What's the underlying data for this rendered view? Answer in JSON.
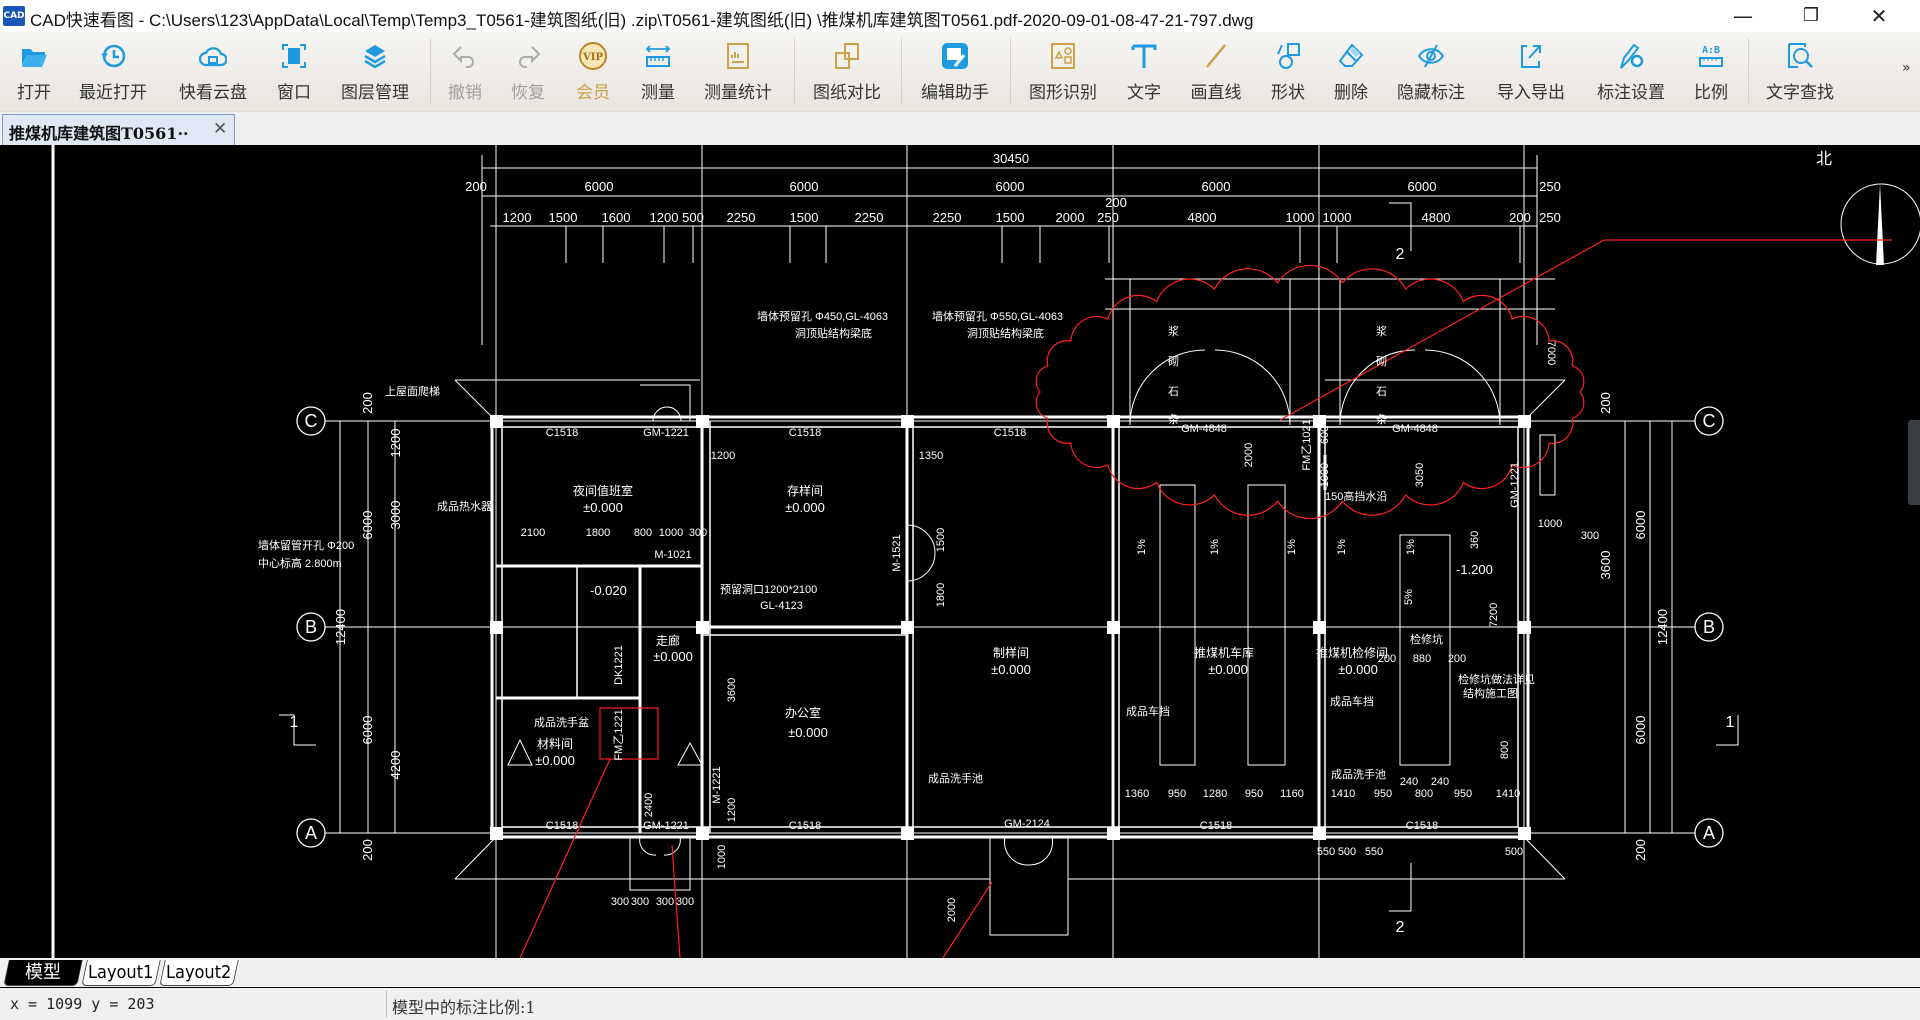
{
  "window": {
    "app_icon": "CAD",
    "title": "CAD快速看图 - C:\\Users\\123\\AppData\\Local\\Temp\\Temp3_T0561-建筑图纸(旧)  .zip\\T0561-建筑图纸(旧)  \\推煤机库建筑图T0561.pdf-2020-09-01-08-47-21-797.dwg",
    "minimize": "—",
    "restore": "❐",
    "close": "✕"
  },
  "toolbar": {
    "items": [
      {
        "label": "打开",
        "icon": "folder-open-icon"
      },
      {
        "label": "最近打开",
        "icon": "recent-clock-icon"
      },
      {
        "label": "快看云盘",
        "icon": "cloud-drive-icon"
      },
      {
        "label": "窗口",
        "icon": "window-icon"
      },
      {
        "label": "图层管理",
        "icon": "layers-icon"
      },
      {
        "label": "撤销",
        "icon": "undo-icon"
      },
      {
        "label": "恢复",
        "icon": "redo-icon"
      },
      {
        "label": "会员",
        "icon": "vip-icon"
      },
      {
        "label": "测量",
        "icon": "ruler-icon"
      },
      {
        "label": "测量统计",
        "icon": "measure-stats-icon"
      },
      {
        "label": "图纸对比",
        "icon": "compare-icon"
      },
      {
        "label": "编辑助手",
        "icon": "edit-assistant-icon"
      },
      {
        "label": "图形识别",
        "icon": "shape-recognize-icon"
      },
      {
        "label": "文字",
        "icon": "text-icon"
      },
      {
        "label": "画直线",
        "icon": "line-icon"
      },
      {
        "label": "形状",
        "icon": "shapes-icon"
      },
      {
        "label": "删除",
        "icon": "eraser-icon"
      },
      {
        "label": "隐藏标注",
        "icon": "hide-eye-icon"
      },
      {
        "label": "导入导出",
        "icon": "import-export-icon"
      },
      {
        "label": "标注设置",
        "icon": "annotation-settings-icon"
      },
      {
        "label": "比例",
        "icon": "scale-icon"
      },
      {
        "label": "文字查找",
        "icon": "text-search-icon"
      }
    ],
    "vip_badge": "VIP",
    "scale_badge": "A:B",
    "more": "»"
  },
  "document_tab": {
    "label": "推煤机库建筑图T0561··",
    "close": "✕"
  },
  "drawing": {
    "axes": {
      "C": "C",
      "B": "B",
      "A": "A"
    },
    "north": "北",
    "section_marks": {
      "one": "1",
      "two": "2"
    },
    "dims_top": {
      "overall": "30450",
      "left_offset": "200",
      "right_offset": "250",
      "bays": [
        "6000",
        "6000",
        "6000",
        "6000",
        "6000"
      ],
      "sub": [
        "1200",
        "1500",
        "1600",
        "1200",
        "500",
        "2250",
        "1500",
        "2250",
        "2250",
        "1500",
        "2000",
        "250",
        "200",
        "4800",
        "1000",
        "1000",
        "4800",
        "200",
        "250"
      ]
    },
    "dims_left": {
      "total": "12400",
      "upper": "6000",
      "lower": "6000",
      "d1": "200",
      "d2": "1200",
      "d3": "3000",
      "d4": "4200",
      "d5": "200"
    },
    "dims_right": {
      "total": "12400",
      "upper": "6000",
      "lower": "6000",
      "d1": "200",
      "d2": "3600",
      "d3": "200"
    },
    "rooms": [
      {
        "name": "夜间值班室",
        "level": "±0.000"
      },
      {
        "name": "存样间",
        "level": "±0.000"
      },
      {
        "name": "制样间",
        "level": "±0.000"
      },
      {
        "name": "推煤机车库",
        "level": "±0.000"
      },
      {
        "name": "推煤机检修间",
        "level": "±0.000"
      },
      {
        "name": "办公室",
        "level": "±0.000"
      },
      {
        "name": "材料间",
        "level": "±0.000"
      },
      {
        "name": "走廊",
        "level": "±0.000"
      }
    ],
    "windows": [
      "C1518",
      "C1518",
      "C1518",
      "C1518",
      "C1518",
      "C1518",
      "C1518"
    ],
    "doors": [
      "GM-1221",
      "GM-1221",
      "GM-4848",
      "GM-4848",
      "GM-2124",
      "M-1521",
      "M-1221",
      "M-1021",
      "FM乙1021",
      "GM-1221",
      "FM乙1221",
      "DK1221"
    ],
    "notes": {
      "hole1": "墙体预留孔 Φ450,GL-4063",
      "hole1b": "洞顶贴结构梁底",
      "hole2": "墙体预留孔 Φ550,GL-4063",
      "hole2b": "洞顶贴结构梁底",
      "ladder": "上屋面爬梯",
      "heater": "成品热水器",
      "vent": "墙体留管开孔 Φ200",
      "vent_b": "中心标高 2.800m",
      "opening": "预留洞口1200*2100",
      "opening_b": "GL-4123",
      "basin1": "成品洗手盆",
      "basin2": "成品洗手池",
      "basin3": "成品洗手池",
      "stop1": "成品车挡",
      "stop2": "成品车挡",
      "drain": "150高挡水沿",
      "pit": "检修坑",
      "pit_note": "检修坑做法详见",
      "pit_note_b": "结构施工图",
      "level_pit": "-1.200",
      "level_wc": "-0.020",
      "slope": "1%",
      "slope5": "5%",
      "stone": [
        "浆",
        "砌",
        "石",
        "条"
      ]
    },
    "misc_dims": [
      "2100",
      "1800",
      "800",
      "1000",
      "300",
      "1200",
      "1350",
      "1500",
      "1800",
      "3600",
      "2400",
      "1200",
      "1000",
      "2000",
      "300",
      "300",
      "300",
      "300",
      "1000",
      "600",
      "2000",
      "3050",
      "7200",
      "1000",
      "300",
      "880",
      "200",
      "200",
      "1360",
      "950",
      "1280",
      "950",
      "1160",
      "1410",
      "950",
      "240",
      "800",
      "240",
      "950",
      "1410",
      "550",
      "500",
      "550",
      "500",
      "7000",
      "800",
      "360"
    ]
  },
  "layout_tabs": [
    "模型",
    "Layout1",
    "Layout2"
  ],
  "status": {
    "coords": "x = 1099  y = 203",
    "scale": "模型中的标注比例:1"
  }
}
